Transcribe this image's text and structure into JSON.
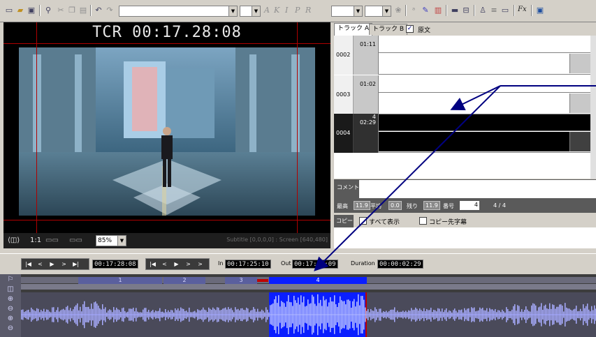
{
  "toolbar": {
    "format_letters": [
      "A",
      "K",
      "I",
      "P",
      "R"
    ],
    "fx_label": "Fx"
  },
  "preview": {
    "timecode": "TCR 00:17.28:08",
    "ratio_label": "1:1",
    "zoom": "85%",
    "info": "Subtitle [0,0,0,0] : Screen [640,480]"
  },
  "tabs": {
    "track_a": "トラック A",
    "track_b": "トラック B",
    "original_check": "✓",
    "original_label": "原文"
  },
  "rows": [
    {
      "num": "0002",
      "start": "",
      "time": "01:11",
      "selected": false
    },
    {
      "num": "0003",
      "start": "",
      "time": "01:02",
      "selected": false
    },
    {
      "num": "0004",
      "start": "4",
      "time": "02:29",
      "selected": true
    }
  ],
  "comment_label": "コメント",
  "stats": {
    "max_label": "最高",
    "max_val": "11.9",
    "avg_label": "平均",
    "avg_val": "0.0",
    "remain_label": "残り",
    "remain_val": "11.9",
    "number_label": "番号",
    "number_val": "4",
    "page": "4 / 4"
  },
  "copy": {
    "label": "コピー",
    "show_all": "すべて表示",
    "copy_first": "コピー先字幕"
  },
  "transport": {
    "current": "00:17:28:08",
    "in_label": "In",
    "in_value": "00:17:25:10",
    "out_label": "Out",
    "out_value": "00:17:28:09",
    "duration_label": "Duration",
    "duration_value": "00:00:02:29"
  },
  "timeline": {
    "clips": [
      "1",
      "2",
      "3",
      "4"
    ]
  },
  "colors": {
    "selection_blue": "#0a1eff",
    "marker_red": "#c00000",
    "arrow_navy": "#000080"
  }
}
